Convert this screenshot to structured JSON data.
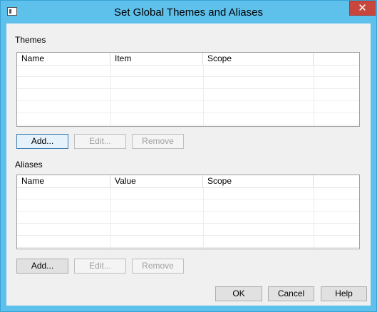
{
  "window": {
    "title": "Set Global Themes and Aliases",
    "close_glyph": "✕"
  },
  "themes": {
    "section_label": "Themes",
    "columns": [
      "Name",
      "Item",
      "Scope"
    ],
    "rows": [],
    "buttons": {
      "add": "Add...",
      "edit": "Edit...",
      "remove": "Remove"
    }
  },
  "aliases": {
    "section_label": "Aliases",
    "columns": [
      "Name",
      "Value",
      "Scope"
    ],
    "rows": [],
    "buttons": {
      "add": "Add...",
      "edit": "Edit...",
      "remove": "Remove"
    }
  },
  "footer": {
    "ok": "OK",
    "cancel": "Cancel",
    "help": "Help"
  },
  "colors": {
    "titlebar": "#5ec1ec",
    "close_button": "#c9463d",
    "dialog_bg": "#f0f0f0"
  },
  "icons": {
    "window_icon": "window-icon",
    "close": "close-icon"
  }
}
